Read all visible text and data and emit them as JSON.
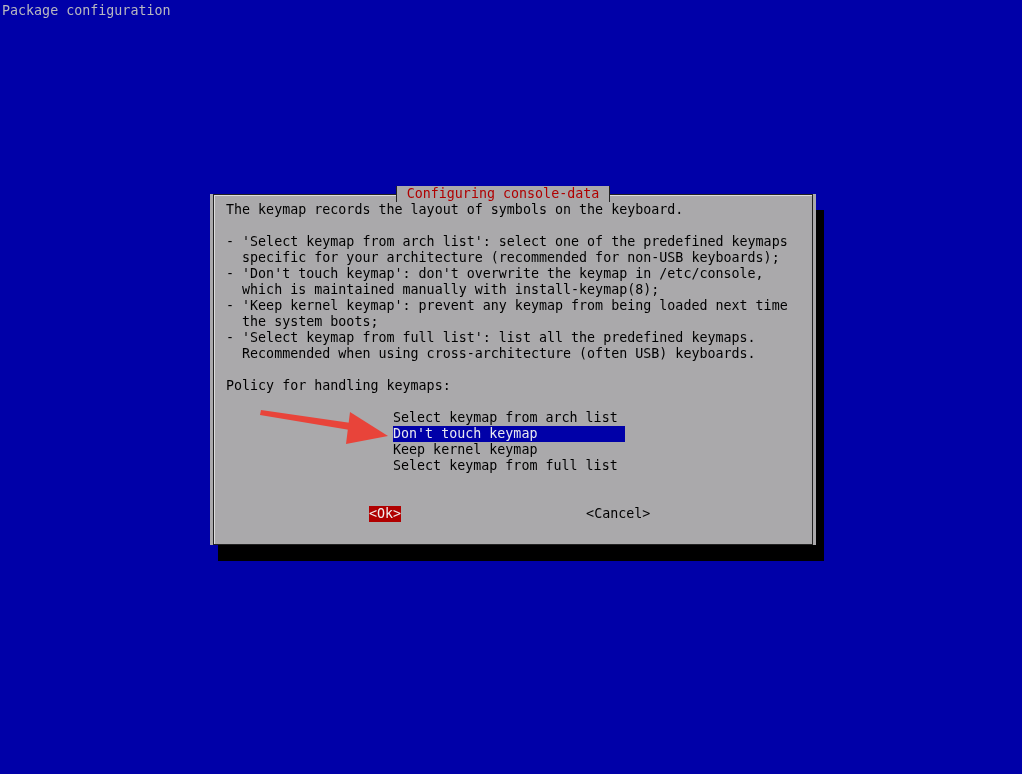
{
  "screen": {
    "title": "Package configuration"
  },
  "dialog": {
    "title": "Configuring console-data",
    "intro": "The keymap records the layout of symbols on the keyboard.",
    "help_items": [
      "- 'Select keymap from arch list': select one of the predefined keymaps\n  specific for your architecture (recommended for non-USB keyboards);",
      "- 'Don't touch keymap': don't overwrite the keymap in /etc/console,\n  which is maintained manually with install-keymap(8);",
      "- 'Keep kernel keymap': prevent any keymap from being loaded next time\n  the system boots;",
      "- 'Select keymap from full list': list all the predefined keymaps.\n  Recommended when using cross-architecture (often USB) keyboards."
    ],
    "prompt": "Policy for handling keymaps:",
    "options": [
      {
        "label": "Select keymap from arch list",
        "selected": false
      },
      {
        "label": "Don't touch keymap",
        "selected": true
      },
      {
        "label": "Keep kernel keymap",
        "selected": false
      },
      {
        "label": "Select keymap from full list",
        "selected": false
      }
    ],
    "buttons": [
      {
        "label": "<Ok>",
        "selected": true
      },
      {
        "label": "<Cancel>",
        "selected": false
      }
    ]
  }
}
